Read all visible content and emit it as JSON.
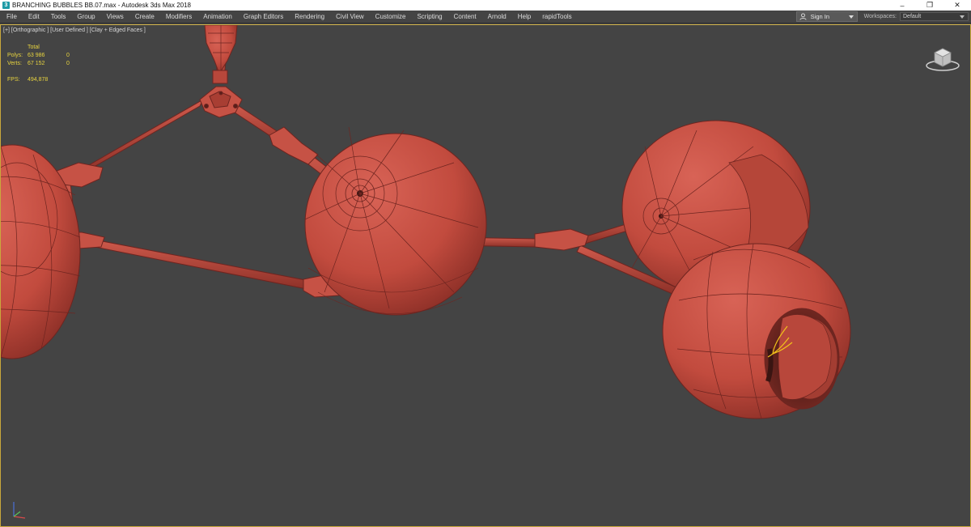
{
  "window": {
    "title": "BRANCHING BUBBLES BB.07.max - Autodesk 3ds Max 2018",
    "minimize": "–",
    "restore": "❐",
    "close": "✕"
  },
  "menu": {
    "items": [
      "File",
      "Edit",
      "Tools",
      "Group",
      "Views",
      "Create",
      "Modifiers",
      "Animation",
      "Graph Editors",
      "Rendering",
      "Civil View",
      "Customize",
      "Scripting",
      "Content",
      "Arnold",
      "Help",
      "rapidTools"
    ],
    "sign_in": "Sign In",
    "workspaces_label": "Workspaces:",
    "workspace_value": "Default"
  },
  "viewport": {
    "label": "[+] [Orthographic ] [User Defined ] [Clay + Edged Faces ]",
    "stats": {
      "header": "Total",
      "polys_label": "Polys:",
      "polys_total": "63 986",
      "polys_selected": "0",
      "verts_label": "Verts:",
      "verts_total": "67 152",
      "verts_selected": "0",
      "fps_label": "FPS:",
      "fps_value": "494,878"
    },
    "colors": {
      "background": "#444444",
      "mesh": "#c94f42",
      "mesh_shadow": "#8e2f28",
      "wire": "#6e2520",
      "border": "#d2b44a",
      "selection": "#f2c21a"
    }
  }
}
